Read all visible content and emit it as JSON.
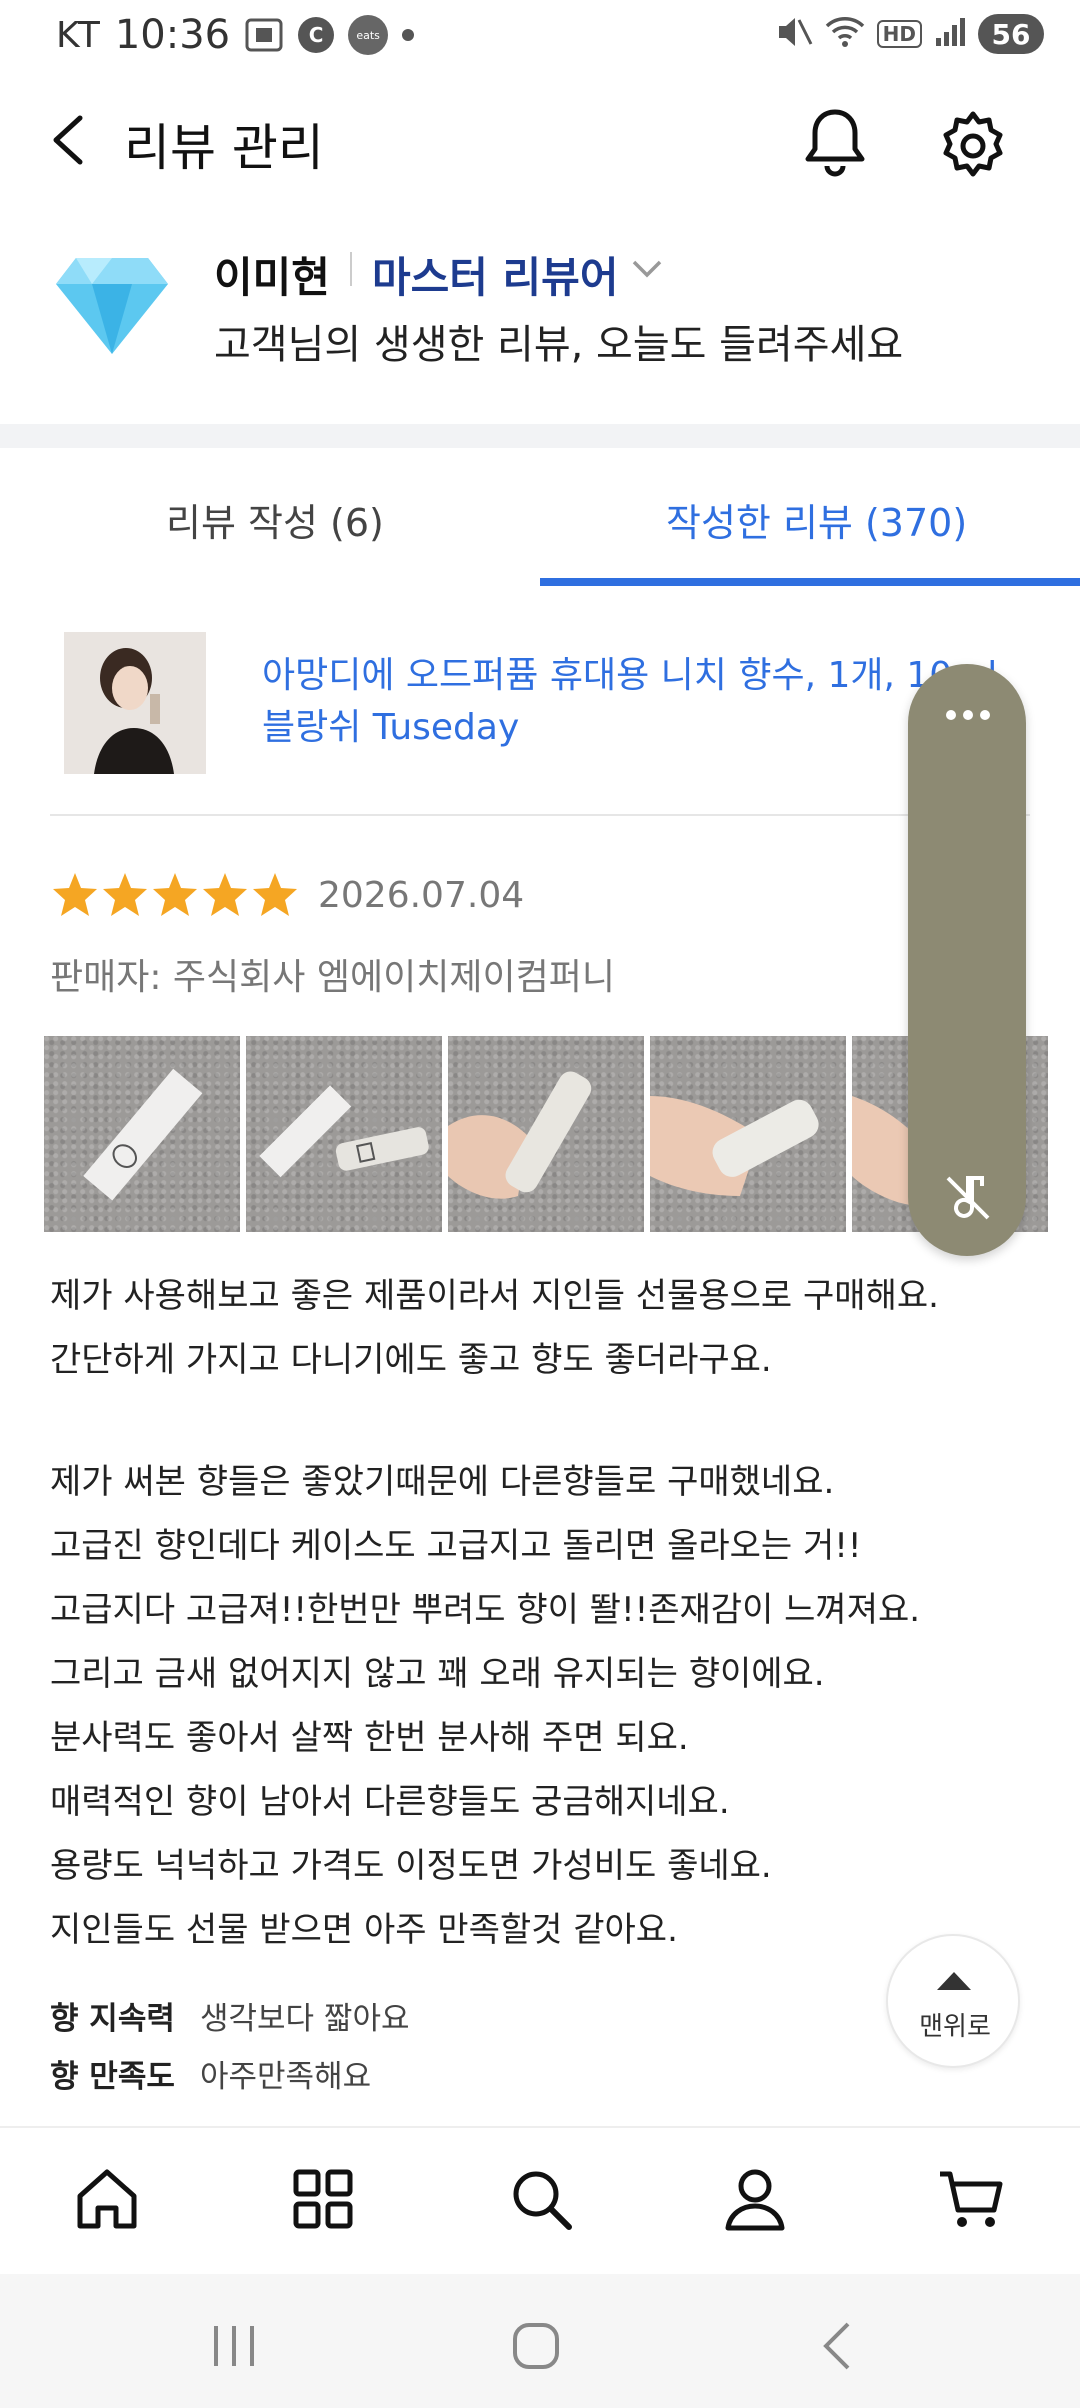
{
  "status_bar": {
    "carrier": "KT",
    "time": "10:36",
    "eats_label": "eats",
    "c_label": "C",
    "battery": "56",
    "hd": "HD"
  },
  "header": {
    "title": "리뷰 관리"
  },
  "profile": {
    "name": "이미현",
    "grade": "마스터 리뷰어",
    "subtitle": "고객님의 생생한 리뷰, 오늘도 들려주세요"
  },
  "tabs": [
    {
      "label": "리뷰 작성 (6)",
      "active": false
    },
    {
      "label": "작성한 리뷰 (370)",
      "active": true
    }
  ],
  "product": {
    "title_line1": "아망디에 오드퍼퓸 휴대용 니치 향수, 1개, 10ml,",
    "title_line2": "블랑쉬 Tuseday"
  },
  "review": {
    "stars": 5,
    "date": "2026.07.04",
    "seller": "판매자: 주식회사 엠에이치제이컴퍼니",
    "lines": [
      "제가 사용해보고 좋은 제품이라서 지인들 선물용으로 구매해요.",
      "간단하게 가지고 다니기에도 좋고 향도 좋더라구요.",
      "",
      "제가 써본 향들은 좋았기때문에 다른향들로 구매했네요.",
      "고급진 향인데다 케이스도 고급지고 돌리면 올라오는 거!!",
      "고급지다 고급져!!한번만 뿌려도 향이 똴!!존재감이 느껴져요.",
      "그리고 금새 없어지지 않고 꽤 오래 유지되는 향이에요.",
      "분사력도 좋아서 살짝 한번 분사해 주면 되요.",
      "매력적인 향이 남아서 다른향들도 궁금해지네요.",
      "용량도 넉넉하고 가격도 이정도면 가성비도 좋네요.",
      "지인들도 선물 받으면 아주 만족할것 같아요."
    ],
    "attributes": [
      {
        "key": "향 지속력",
        "value": "생각보다 짧아요"
      },
      {
        "key": "향 만족도",
        "value": "아주만족해요"
      }
    ]
  },
  "scroll_top": {
    "label": "맨위로"
  },
  "bottom_nav": [
    "home-icon",
    "categories-icon",
    "search-icon",
    "user-icon",
    "cart-icon"
  ],
  "colors": {
    "accent": "#2f6fe0",
    "grade": "#1d3b8f",
    "star": "#f5a623",
    "edge_panel": "#8d8a73"
  }
}
